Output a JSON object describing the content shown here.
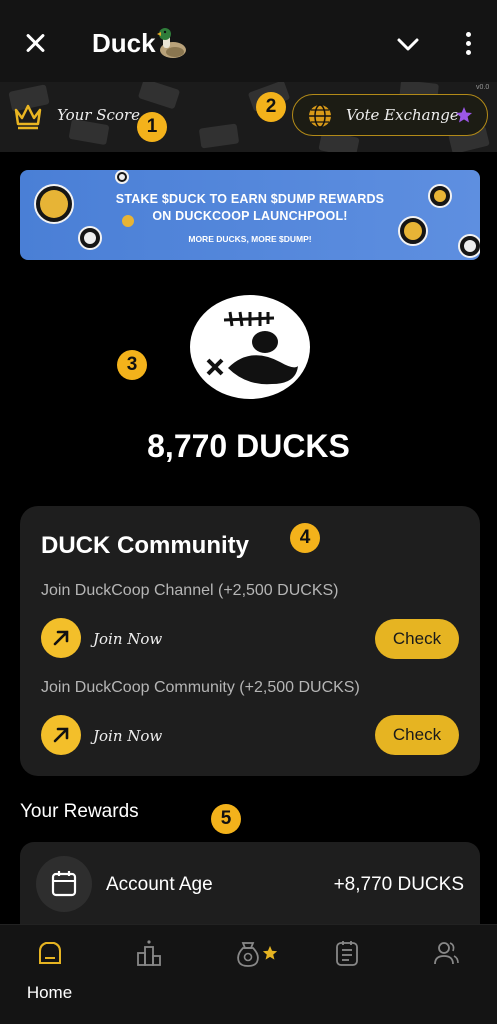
{
  "header": {
    "title": "Duck",
    "title_emoji": "duck-emoji",
    "close_icon": "close-icon",
    "chevron_icon": "chevron-down-icon",
    "more_icon": "more-vertical-icon"
  },
  "score_bar": {
    "score_label": "Your Score",
    "vote_exchange_label": "Vote Exchange",
    "version": "v0.0"
  },
  "annotations": [
    "1",
    "2",
    "3",
    "4",
    "5"
  ],
  "banner": {
    "line1": "STAKE $DUCK TO EARN $DUMP REWARDS",
    "line2": "ON DUCKCOOP LAUNCHPOOL!",
    "subline": "MORE DUCKS, MORE $DUMP!",
    "color": "#4a7fd6"
  },
  "balance": {
    "amount_text": "8,770 DUCKS"
  },
  "community": {
    "title": "DUCK Community",
    "tasks": [
      {
        "label": "Join DuckCoop Channel (+2,500 DUCKS)",
        "join_label": "Join Now",
        "check_label": "Check"
      },
      {
        "label": "Join DuckCoop Community (+2,500 DUCKS)",
        "join_label": "Join Now",
        "check_label": "Check"
      }
    ]
  },
  "rewards": {
    "title": "Your Rewards",
    "items": [
      {
        "name": "Account Age",
        "value": "+8,770 DUCKS",
        "icon": "calendar-icon"
      }
    ]
  },
  "bottom_nav": {
    "items": [
      {
        "label": "Home",
        "icon": "home-icon",
        "active": true
      },
      {
        "label": "",
        "icon": "leaderboard-icon"
      },
      {
        "label": "",
        "icon": "money-bag-icon"
      },
      {
        "label": "",
        "icon": "tasks-icon"
      },
      {
        "label": "",
        "icon": "friends-icon"
      }
    ]
  },
  "colors": {
    "accent": "#f3b21b",
    "background": "#000000",
    "card": "#1e1e1e",
    "check_button": "#e6b422"
  }
}
